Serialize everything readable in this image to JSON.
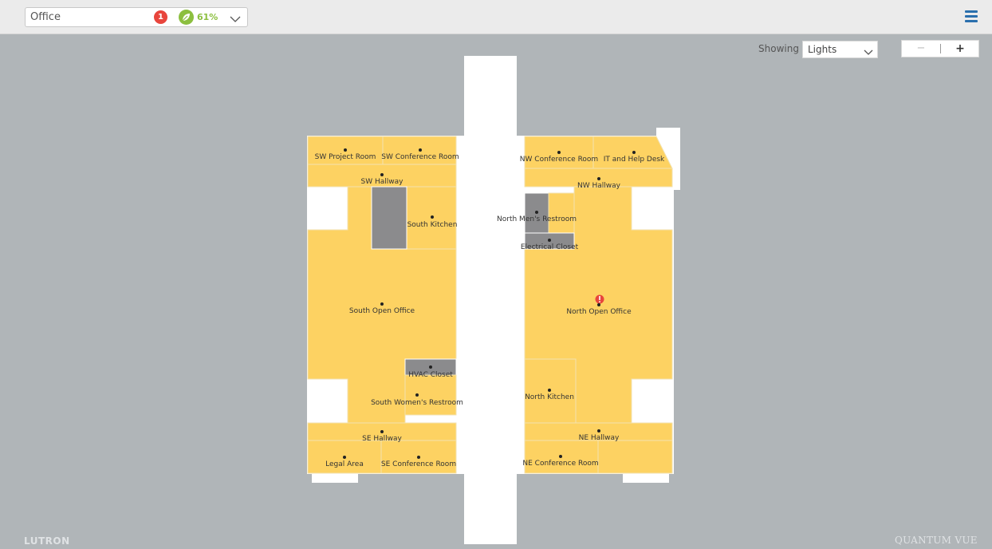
{
  "header": {
    "area_name": "Office",
    "alert_count": "1",
    "energy_percent": "61%"
  },
  "view": {
    "showing_label": "Showing",
    "showing_value": "Lights",
    "zoom_out": "−",
    "zoom_in": "+"
  },
  "rooms": [
    {
      "name": "SW Project Room",
      "id": "sw-project-room"
    },
    {
      "name": "SW Conference Room",
      "id": "sw-conference-room"
    },
    {
      "name": "SW Hallway",
      "id": "sw-hallway"
    },
    {
      "name": "South Kitchen",
      "id": "south-kitchen"
    },
    {
      "name": "South Open Office",
      "id": "south-open-office"
    },
    {
      "name": "HVAC Closet",
      "id": "hvac-closet"
    },
    {
      "name": "South Women's Restroom",
      "id": "south-womens-restroom"
    },
    {
      "name": "SE Hallway",
      "id": "se-hallway"
    },
    {
      "name": "Legal Area",
      "id": "legal-area"
    },
    {
      "name": "SE Conference Room",
      "id": "se-conference-room"
    },
    {
      "name": "NW Conference Room",
      "id": "nw-conference-room"
    },
    {
      "name": "IT and Help Desk",
      "id": "it-and-help-desk"
    },
    {
      "name": "NW Hallway",
      "id": "nw-hallway"
    },
    {
      "name": "North Men's Restroom",
      "id": "north-mens-restroom"
    },
    {
      "name": "Electrical Closet",
      "id": "electrical-closet"
    },
    {
      "name": "North Open Office",
      "id": "north-open-office"
    },
    {
      "name": "North Kitchen",
      "id": "north-kitchen"
    },
    {
      "name": "NE Hallway",
      "id": "ne-hallway"
    },
    {
      "name": "NE Conference Room",
      "id": "ne-conference-room"
    }
  ],
  "footer": {
    "brand": "LUTRON",
    "product": "QUANTUM VUE"
  },
  "colors": {
    "room_on": "#fdd262",
    "room_off": "#8b8b8d",
    "background": "#b0b5b8",
    "alert": "#e8453c",
    "energy": "#8cbf3f",
    "accent": "#2a6fad"
  },
  "icons": {
    "alert": "alert-badge",
    "energy": "leaf-icon",
    "menu": "hamburger-menu-icon"
  }
}
